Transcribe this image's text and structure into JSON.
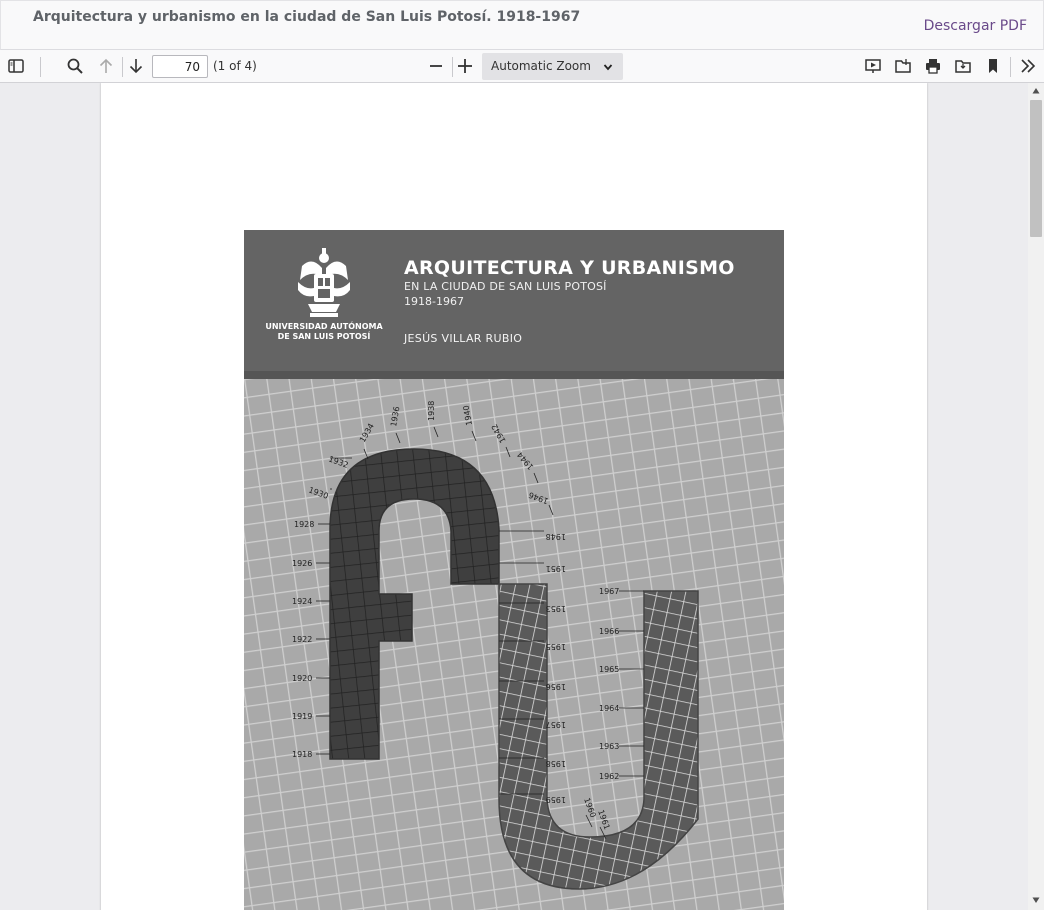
{
  "header": {
    "title": "Arquitectura y urbanismo en la ciudad de San Luis Potosí. 1918-1967",
    "download_label": "Descargar PDF"
  },
  "toolbar": {
    "page_number": "70",
    "page_count": "(1 of 4)",
    "zoom_label": "Automatic Zoom",
    "icons": [
      "sidebar-toggle-icon",
      "search-icon",
      "arrow-up-icon",
      "arrow-down-icon",
      "minus-icon",
      "plus-icon",
      "presentation-icon",
      "open-file-icon",
      "print-icon",
      "save-icon",
      "bookmark-icon",
      "double-chevron-right-icon"
    ]
  },
  "cover": {
    "university_line1": "UNIVERSIDAD AUTÓNOMA",
    "university_line2": "DE SAN LUIS POTOSÍ",
    "title": "ARQUITECTURA Y URBANISMO",
    "subtitle": "EN LA CIUDAD DE SAN LUIS POTOSÍ",
    "years": "1918-1967",
    "author": "JESÚS VILLAR RUBIO",
    "years_left": [
      "1932",
      "1930",
      "1928",
      "1926",
      "1924",
      "1922",
      "1920",
      "1919",
      "1918"
    ],
    "years_arch": [
      "1934",
      "1936",
      "1938",
      "1940",
      "1942",
      "1944",
      "1946"
    ],
    "years_mid": [
      "1948",
      "1951",
      "1953",
      "1955",
      "1956",
      "1957",
      "1958",
      "1959",
      "1960",
      "1961"
    ],
    "years_right": [
      "1967",
      "1966",
      "1965",
      "1964",
      "1963",
      "1962"
    ]
  },
  "colors": {
    "accent_link": "#6a4a8a",
    "cover_header": "#646464",
    "viewer_bg": "#ececef"
  }
}
